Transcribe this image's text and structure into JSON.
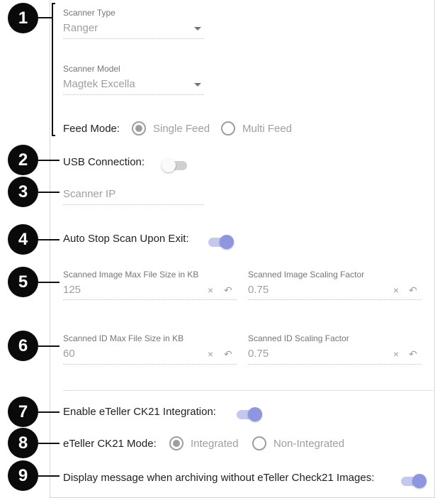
{
  "callouts": [
    "1",
    "2",
    "3",
    "4",
    "5",
    "6",
    "7",
    "8",
    "9"
  ],
  "scanner_type": {
    "label": "Scanner Type",
    "value": "Ranger"
  },
  "scanner_model": {
    "label": "Scanner Model",
    "value": "Magtek Excella"
  },
  "feed_mode": {
    "label": "Feed Mode:",
    "options": [
      "Single Feed",
      "Multi Feed"
    ],
    "selected": "Single Feed"
  },
  "usb_connection": {
    "label": "USB Connection:",
    "enabled": false
  },
  "scanner_ip": {
    "placeholder": "Scanner IP"
  },
  "auto_stop": {
    "label": "Auto Stop Scan Upon Exit:",
    "enabled": true
  },
  "image_max_size": {
    "label": "Scanned Image Max File Size in KB",
    "value": "125"
  },
  "image_scaling": {
    "label": "Scanned Image Scaling Factor",
    "value": "0.75"
  },
  "id_max_size": {
    "label": "Scanned ID Max File Size in KB",
    "value": "60"
  },
  "id_scaling": {
    "label": "Scanned ID Scaling Factor",
    "value": "0.75"
  },
  "ck21_integration": {
    "label": "Enable eTeller CK21 Integration:",
    "enabled": true
  },
  "ck21_mode": {
    "label": "eTeller CK21 Mode:",
    "options": [
      "Integrated",
      "Non-Integrated"
    ],
    "selected": "Integrated"
  },
  "archive_message": {
    "label": "Display message when archiving without eTeller Check21 Images:",
    "enabled": true
  },
  "icons": {
    "clear": "×",
    "reset": "↶"
  },
  "colors": {
    "accent": "#8f96e0",
    "accent_track": "#c5c8ee",
    "callout": "#0a0a0a"
  }
}
